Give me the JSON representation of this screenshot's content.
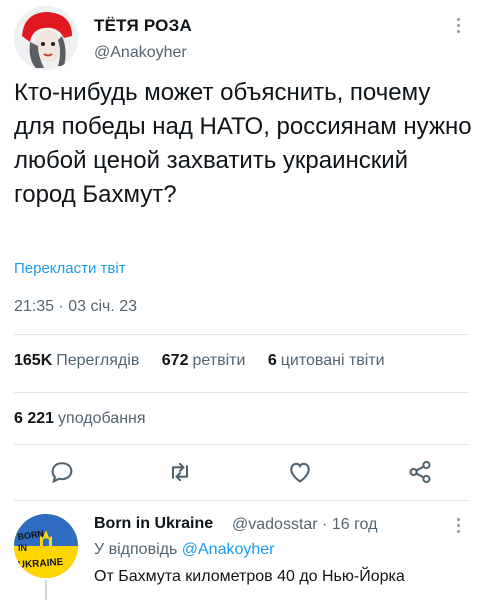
{
  "tweet": {
    "display_name": "ТЁТЯ РОЗА",
    "handle": "@Anakoyher",
    "text": "Кто-нибудь может объяснить, почему для победы над НАТО, россиянам нужно любой ценой захватить украинский город Бахмут?",
    "translate_label": "Перекласти твіт",
    "timestamp": "21:35 · 03 січ. 23",
    "stats": {
      "views_count": "165K",
      "views_label": "Переглядів",
      "retweets_count": "672",
      "retweets_label": "ретвіти",
      "quotes_count": "6",
      "quotes_label": "цитовані твіти"
    },
    "likes": {
      "count": "6 221",
      "label": "уподобання"
    }
  },
  "actions": [
    "reply-icon",
    "retweet-icon",
    "like-icon",
    "share-icon"
  ],
  "reply": {
    "display_name": "Born in Ukraine",
    "handle_time": "@vadosstar · 16 год",
    "replying_prefix": "У відповідь",
    "replying_to": "@Anakoyher",
    "text": "От Бахмута километров 40 до Нью-Йорка",
    "avatar_text": "BORN IN UKRAINE"
  },
  "colors": {
    "accent": "#1d9bf0",
    "secondary_text": "#536471",
    "primary_text": "#0f1419",
    "divider": "#e3e6e8"
  }
}
